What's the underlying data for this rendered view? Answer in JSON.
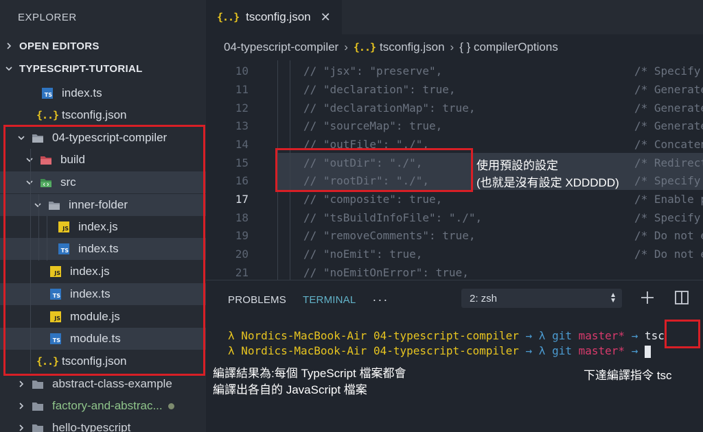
{
  "explorer": {
    "title": "EXPLORER",
    "sections": {
      "open_editors": "OPEN EDITORS",
      "project": "TYPESCRIPT-TUTORIAL"
    },
    "items": {
      "f1": "index.ts",
      "f2": "tsconfig.json",
      "d1": "04-typescript-compiler",
      "d2": "build",
      "d3": "src",
      "d4": "inner-folder",
      "f3": "index.js",
      "f4": "index.ts",
      "f5": "index.js",
      "f6": "index.ts",
      "f7": "module.js",
      "f8": "module.ts",
      "f9": "tsconfig.json",
      "d5": "abstract-class-example",
      "d6": "factory-and-abstrac...",
      "d7": "hello-typescript"
    }
  },
  "editor": {
    "tab_label": "tsconfig.json",
    "breadcrumb": [
      "04-typescript-compiler",
      "tsconfig.json",
      "{ } compilerOptions"
    ],
    "lines": [
      {
        "num": "10",
        "code": "// \"jsx\": \"preserve\",",
        "comment": "/* Specify JS"
      },
      {
        "num": "11",
        "code": "// \"declaration\": true,",
        "comment": "/* Generates"
      },
      {
        "num": "12",
        "code": "// \"declarationMap\": true,",
        "comment": "/* Generates"
      },
      {
        "num": "13",
        "code": "// \"sourceMap\": true,",
        "comment": "/* Generates"
      },
      {
        "num": "14",
        "code": "// \"outFile\": \"./\",",
        "comment": "/* Concatenat"
      },
      {
        "num": "15",
        "code": "// \"outDir\": \"./\",",
        "comment": "/* Redirect o"
      },
      {
        "num": "16",
        "code": "// \"rootDir\": \"./\",",
        "comment": "/* Specify th"
      },
      {
        "num": "17",
        "code": "// \"composite\": true,",
        "comment": "/* Enable pro"
      },
      {
        "num": "18",
        "code": "// \"tsBuildInfoFile\": \"./\",",
        "comment": "/* Specify fi"
      },
      {
        "num": "19",
        "code": "// \"removeComments\": true,",
        "comment": "/* Do not emi"
      },
      {
        "num": "20",
        "code": "// \"noEmit\": true,",
        "comment": "/* Do not emi"
      },
      {
        "num": "21",
        "code": "// \"noEmitOnError\": true,",
        "comment": ""
      }
    ]
  },
  "annotations": {
    "note1_line1": "使用預設的設定",
    "note1_line2": "(也就是沒有設定 XDDDDD)",
    "note2_line1": "編譯結果為:每個 TypeScript 檔案都會",
    "note2_line2": "編譯出各自的 JavaScript 檔案",
    "note3": "下達編譯指令 tsc"
  },
  "panel": {
    "tabs": [
      "PROBLEMS",
      "TERMINAL"
    ],
    "more": "···",
    "shell": "2: zsh",
    "terminal": {
      "lambda": "λ",
      "host": "Nordics-MacBook-Air",
      "dir": "04-typescript-compiler",
      "arrow": "→",
      "git": "git",
      "branch": "master*",
      "cmd1": "tsc"
    }
  },
  "colors": {
    "highlight_box": "#d81f26",
    "terminal_yellow": "#e8c520",
    "terminal_blue": "#4b9bd1",
    "terminal_pink": "#d93a6c",
    "active_tab": "#62b3c9"
  },
  "icons": [
    "folder-icon",
    "folder-open-icon",
    "ts-file-icon",
    "js-file-icon",
    "json-file-icon",
    "chevron-right-icon",
    "chevron-down-icon",
    "close-icon",
    "plus-icon",
    "split-icon"
  ]
}
